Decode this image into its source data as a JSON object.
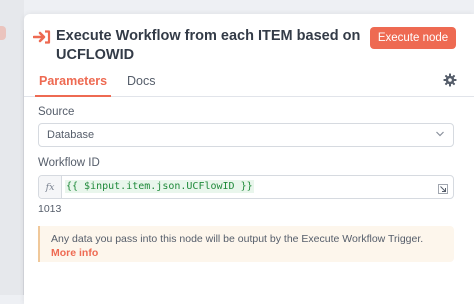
{
  "header": {
    "title": "Execute Workflow from each ITEM based on UCFLOWID",
    "execute_button": "Execute node"
  },
  "tabs": [
    {
      "label": "Parameters",
      "active": true
    },
    {
      "label": "Docs",
      "active": false
    }
  ],
  "source": {
    "label": "Source",
    "value": "Database"
  },
  "workflow_id": {
    "label": "Workflow ID",
    "fx": "fx",
    "expression": "{{ $input.item.json.UCFlowID }}",
    "result": "1013"
  },
  "notice": {
    "message": "Any data you pass into this node will be output by the Execute Workflow Trigger.",
    "link": "More info"
  },
  "colors": {
    "accent": "#ee6a52",
    "expression_green": "#1f8a3a",
    "notice_bg": "#fdf6ec"
  },
  "icons": [
    "sign-in-arrow-icon",
    "gear-icon",
    "chevron-down-icon",
    "expand-icon"
  ]
}
